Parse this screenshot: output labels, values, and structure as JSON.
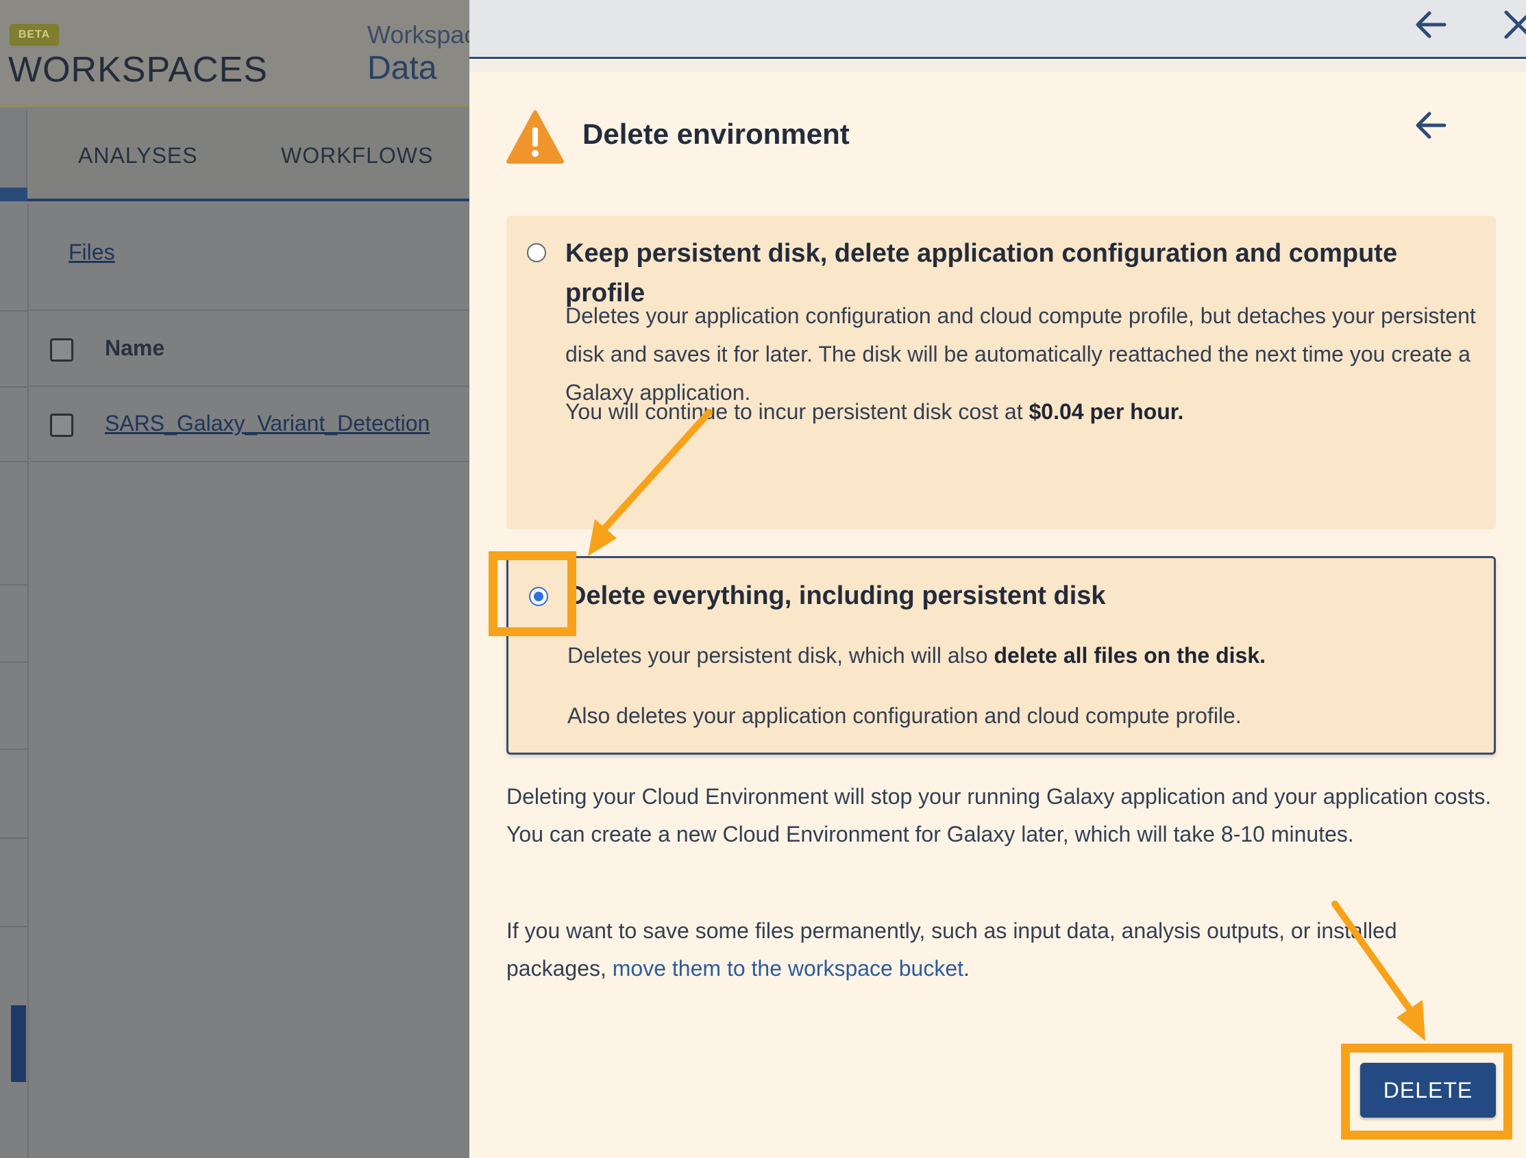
{
  "app": {
    "beta_badge": "BETA",
    "brand": "WORKSPACES",
    "workspace_label": "Workspac",
    "workspace_name": "Data"
  },
  "background": {
    "tabs": [
      "ANALYSES",
      "WORKFLOWS"
    ],
    "files_link": "Files",
    "table": {
      "column_name": "Name",
      "rows": [
        "SARS_Galaxy_Variant_Detection"
      ]
    }
  },
  "drawer": {
    "title": "Delete environment",
    "options": [
      {
        "title": "Keep persistent disk, delete application configuration and compute profile",
        "text1": "Deletes your application configuration and cloud compute profile, but detaches your persistent disk and saves it for later. The disk will be automatically reattached the next time you create a Galaxy application.",
        "text2_prefix": "You will continue to incur persistent disk cost at ",
        "text2_bold": "$0.04 per hour.",
        "selected": false
      },
      {
        "title": "Delete everything, including persistent disk",
        "text1_prefix": "Deletes your persistent disk, which will also ",
        "text1_bold": "delete all files on the disk.",
        "text2": "Also deletes your application configuration and cloud compute profile.",
        "selected": true
      }
    ],
    "info": "Deleting your Cloud Environment will stop your running Galaxy application and your application costs. You can create a new Cloud Environment for Galaxy later, which will take 8-10 minutes.",
    "save_prefix": "If you want to save some files permanently, such as input data, analysis outputs, or installed packages, ",
    "save_link": "move them to the workspace bucket",
    "save_suffix": ".",
    "delete_button": "DELETE"
  },
  "colors": {
    "drawer_bg": "#fdf4e6",
    "option_bg": "#fae6c9",
    "primary": "#234a82",
    "warning": "#f0952b",
    "annotation": "#f7a21a",
    "radio_selected": "#2f6fe0"
  },
  "icons": [
    "back-arrow-icon",
    "close-icon",
    "warning-icon"
  ]
}
